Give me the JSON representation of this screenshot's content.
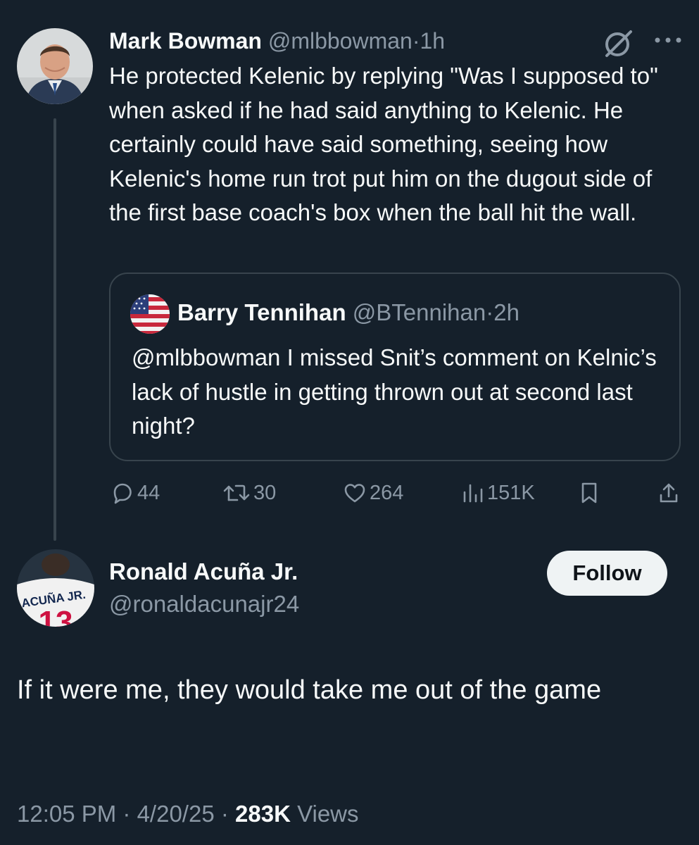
{
  "parent_tweet": {
    "author_name": "Mark Bowman",
    "handle": "@mlbbowman",
    "separator": "·",
    "time": "1h",
    "text": "He protected Kelenic by replying \"Was I supposed to\" when asked if he had said anything to Kelenic.  He certainly could have said something, seeing how Kelenic's home run trot put him on the dugout side of the first base coach's box when the ball hit the wall.",
    "quoted": {
      "author_name": "Barry Tennihan",
      "handle": "@BTennihan",
      "separator": "·",
      "time": "2h",
      "text": "@mlbbowman I missed Snit’s comment on Kelnic’s lack of hustle in getting thrown out at second last night?"
    },
    "actions": {
      "replies": "44",
      "reposts": "30",
      "likes": "264",
      "views": "151K"
    },
    "icons": [
      "grok-icon",
      "more-icon",
      "reply-icon",
      "repost-icon",
      "like-icon",
      "views-icon",
      "bookmark-icon",
      "share-icon"
    ]
  },
  "main_tweet": {
    "author_name": "Ronald Acuña Jr.",
    "handle": "@ronaldacunajr24",
    "follow_label": "Follow",
    "text": "If it were me, they would take me out of the game",
    "timestamp": "12:05 PM · 4/20/25 · ",
    "views_count": "283K",
    "views_label": " Views",
    "avatar_jersey_text": "ACUÑA JR.",
    "avatar_jersey_number": "13"
  },
  "colors": {
    "background": "#15202b",
    "text": "#f7f9f9",
    "muted": "#8b98a5",
    "border": "#38444d",
    "follow_bg": "#eff3f4"
  }
}
